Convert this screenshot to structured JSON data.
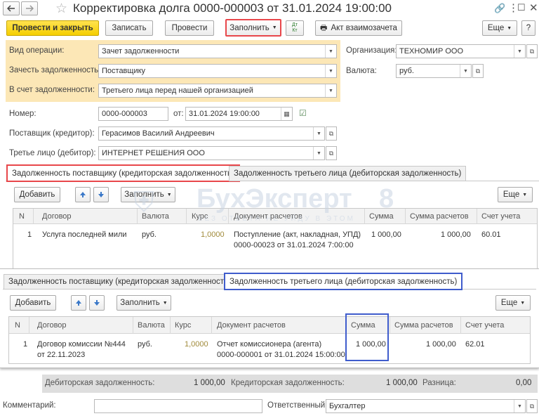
{
  "window": {
    "title": "Корректировка долга 0000-000003 от 31.01.2024 19:00:00"
  },
  "toolbar": {
    "post_close": "Провести и закрыть",
    "save": "Записать",
    "post": "Провести",
    "fill": "Заполнить",
    "act": "Акт взаимозачета",
    "more": "Еще",
    "dtkt": "Дт Кт"
  },
  "form": {
    "op_type_label": "Вид операции:",
    "op_type": "Зачет задолженности",
    "offset_label": "Зачесть задолженность:",
    "offset": "Поставщику",
    "against_label": "В счет задолженности:",
    "against": "Третьего лица перед нашей организацией",
    "org_label": "Организация:",
    "org": "ТЕХНОМИР ООО",
    "currency_label": "Валюта:",
    "currency": "руб.",
    "number_label": "Номер:",
    "number": "0000-000003",
    "date_label": "от:",
    "date": "31.01.2024 19:00:00",
    "supplier_label": "Поставщик (кредитор):",
    "supplier": "Герасимов Василий Андреевич",
    "third_label": "Третье лицо (дебитор):",
    "third": "ИНТЕРНЕТ РЕШЕНИЯ ООО"
  },
  "tabs": {
    "supplier": "Задолженность поставщику (кредиторская задолженность)",
    "third": "Задолженность третьего лица (дебиторская задолженность)"
  },
  "table_toolbar": {
    "add": "Добавить",
    "fill": "Заполнить",
    "more": "Еще"
  },
  "table1": {
    "headers": {
      "n": "N",
      "contract": "Договор",
      "currency": "Валюта",
      "rate": "Курс",
      "doc": "Документ расчетов",
      "sum": "Сумма",
      "sum_calc": "Сумма расчетов",
      "account": "Счет учета"
    },
    "row": {
      "n": "1",
      "contract": "Услуга последней мили",
      "currency": "руб.",
      "rate": "1,0000",
      "doc1": "Поступление (акт, накладная, УПД)",
      "doc2": "0000-00023 от 31.01.2024 7:00:00",
      "sum": "1 000,00",
      "sum_calc": "1 000,00",
      "account": "60.01"
    }
  },
  "table2": {
    "headers": {
      "n": "N",
      "contract": "Договор",
      "currency": "Валюта",
      "rate": "Курс",
      "doc": "Документ расчетов",
      "sum": "Сумма",
      "sum_calc": "Сумма расчетов",
      "account": "Счет учета"
    },
    "row": {
      "n": "1",
      "contract1": "Договор комиссии №444",
      "contract2": "от 22.11.2023",
      "currency": "руб.",
      "rate": "1,0000",
      "doc1": "Отчет комиссионера (агента)",
      "doc2": "0000-000001 от 31.01.2024 15:00:00",
      "sum": "1 000,00",
      "sum_calc": "1 000,00",
      "account": "62.01"
    }
  },
  "totals": {
    "debit_label": "Дебиторская задолженность:",
    "debit": "1 000,00",
    "credit_label": "Кредиторская задолженность:",
    "credit": "1 000,00",
    "diff_label": "Разница:",
    "diff": "0,00"
  },
  "footer": {
    "comment_label": "Комментарий:",
    "comment": "",
    "responsible_label": "Ответственный:",
    "responsible": "Бухгалтер"
  },
  "watermark": {
    "brand": "БухЭксперт",
    "digit": "8",
    "tagline": "БЕЗ ОТВЕТА НЕ УЙДУ В ЭТОМ"
  },
  "colors": {
    "accent_red": "#e8474b",
    "accent_blue": "#3f5ccc",
    "primary": "#f5cf00",
    "highlight": "#fce7b6"
  }
}
